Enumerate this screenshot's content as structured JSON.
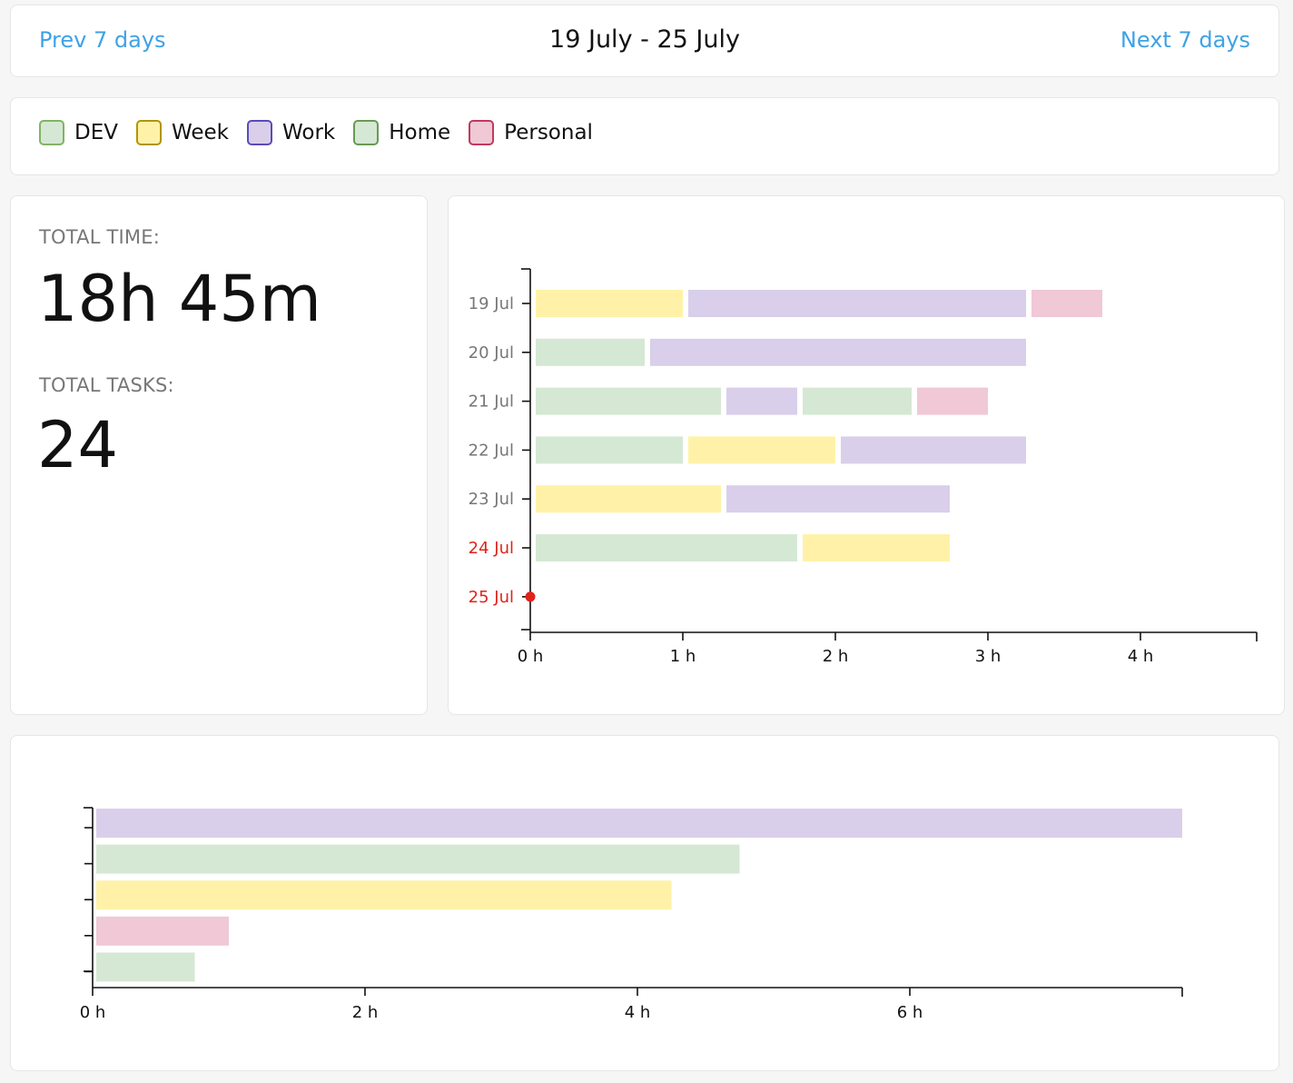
{
  "nav": {
    "prev_label": "Prev 7 days",
    "range_label": "19 July - 25 July",
    "next_label": "Next 7 days"
  },
  "colors": {
    "link": "#3fa2e6",
    "today": "#e2231a",
    "DEV": {
      "fill": "#d5e8d4",
      "border": "#82b366"
    },
    "Week": {
      "fill": "#fff2a8",
      "border": "#b09500"
    },
    "Work": {
      "fill": "#d9cfea",
      "border": "#5b4bb7"
    },
    "Home": {
      "fill": "#d5e8d4",
      "border": "#6a9955"
    },
    "Personal": {
      "fill": "#f0c8d6",
      "border": "#c0395e"
    }
  },
  "legend": [
    {
      "label": "DEV",
      "category": "DEV"
    },
    {
      "label": "Week",
      "category": "Week"
    },
    {
      "label": "Work",
      "category": "Work"
    },
    {
      "label": "Home",
      "category": "Home"
    },
    {
      "label": "Personal",
      "category": "Personal"
    }
  ],
  "summary": {
    "total_time_label": "TOTAL TIME:",
    "total_time_value": "18h 45m",
    "total_tasks_label": "TOTAL TASKS:",
    "total_tasks_value": "24"
  },
  "chart_data": [
    {
      "type": "bar",
      "orientation": "horizontal",
      "stacked": true,
      "categories": [
        "19 Jul",
        "20 Jul",
        "21 Jul",
        "22 Jul",
        "23 Jul",
        "24 Jul",
        "25 Jul"
      ],
      "highlighted_categories": [
        "24 Jul",
        "25 Jul"
      ],
      "x_ticks": [
        "0 h",
        "1 h",
        "2 h",
        "3 h",
        "4 h"
      ],
      "xlim": [
        0,
        4.75
      ],
      "x_unit": "h",
      "segments": [
        [
          {
            "category": "Week",
            "hours": 1.0
          },
          {
            "category": "Work",
            "hours": 2.25
          },
          {
            "category": "Personal",
            "hours": 0.5
          }
        ],
        [
          {
            "category": "Home",
            "hours": 0.75
          },
          {
            "category": "Work",
            "hours": 2.5
          }
        ],
        [
          {
            "category": "Home",
            "hours": 1.25
          },
          {
            "category": "Work",
            "hours": 0.5
          },
          {
            "category": "Home",
            "hours": 0.75
          },
          {
            "category": "Personal",
            "hours": 0.5
          }
        ],
        [
          {
            "category": "Home",
            "hours": 1.0
          },
          {
            "category": "Week",
            "hours": 1.0
          },
          {
            "category": "Work",
            "hours": 1.25
          }
        ],
        [
          {
            "category": "Week",
            "hours": 1.25
          },
          {
            "category": "Work",
            "hours": 1.5
          }
        ],
        [
          {
            "category": "Home",
            "hours": 1.75
          },
          {
            "category": "Week",
            "hours": 1.0
          }
        ],
        []
      ],
      "marker": {
        "category": "25 Jul",
        "x": 0
      }
    },
    {
      "type": "bar",
      "orientation": "horizontal",
      "categories": [
        "Work",
        "Home",
        "Week",
        "Personal",
        "DEV"
      ],
      "values": [
        8.0,
        4.75,
        4.25,
        1.0,
        0.75
      ],
      "x_ticks": [
        "0 h",
        "2 h",
        "4 h",
        "6 h"
      ],
      "xlim": [
        0,
        8
      ],
      "x_unit": "h"
    }
  ]
}
